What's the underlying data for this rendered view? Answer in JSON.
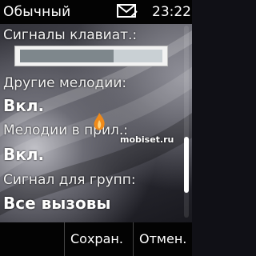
{
  "status_bar": {
    "profile": "Обычный",
    "message_icon": "envelope-icon",
    "time": "23:22"
  },
  "settings": {
    "key_tones": {
      "label": "Сигналы клавиат.:",
      "level": 0.66
    },
    "other_tones": {
      "label": "Другие мелодии:",
      "value": "Вкл."
    },
    "app_tones": {
      "label": "Мелодии в прил.:",
      "value": "Вкл."
    },
    "group_alert": {
      "label": "Сигнал для групп:",
      "value": "Все вызовы"
    }
  },
  "watermark": {
    "text": "mobiset.ru",
    "logo_icon": "flame-logo-icon"
  },
  "scrollbar": {
    "position": 0.82
  },
  "softkeys": {
    "save": "Сохран.",
    "cancel": "Отмен."
  },
  "colors": {
    "status_bar": "#030303",
    "slider_fill": "#7e878c",
    "slider_track": "#c9d0d4",
    "watermark_logo": "#f08a1a"
  }
}
